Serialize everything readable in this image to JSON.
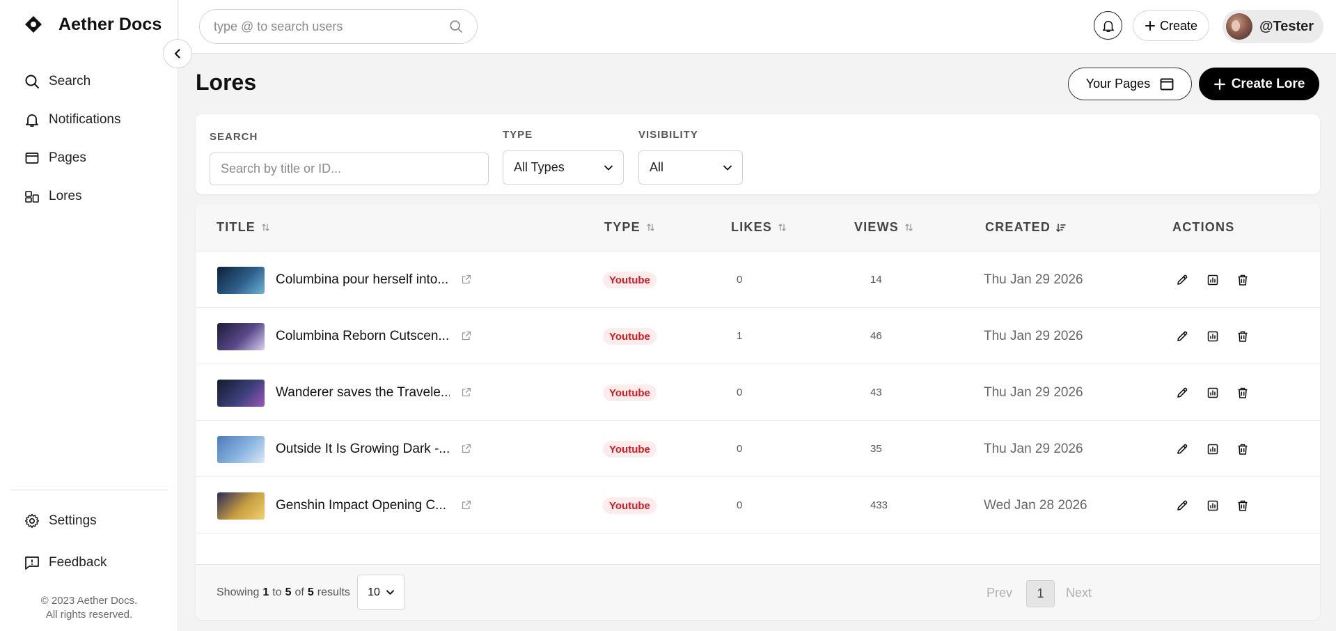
{
  "app": {
    "name": "Aether Docs"
  },
  "sidebar": {
    "items": [
      {
        "label": "Search",
        "icon": "search-icon"
      },
      {
        "label": "Notifications",
        "icon": "bell-icon"
      },
      {
        "label": "Pages",
        "icon": "window-icon"
      },
      {
        "label": "Lores",
        "icon": "layout-icon"
      }
    ],
    "bottom_items": [
      {
        "label": "Settings",
        "icon": "gear-icon"
      },
      {
        "label": "Feedback",
        "icon": "message-icon"
      }
    ],
    "copyright_line1": "© 2023 Aether Docs.",
    "copyright_line2": "All rights reserved."
  },
  "topbar": {
    "search_placeholder": "type @ to search users",
    "create_label": "Create",
    "username": "@Tester"
  },
  "page": {
    "title": "Lores",
    "your_pages_label": "Your Pages",
    "create_lore_label": "Create Lore"
  },
  "filters": {
    "search_label": "SEARCH",
    "search_placeholder": "Search by title or ID...",
    "type_label": "TYPE",
    "type_value": "All Types",
    "visibility_label": "VISIBILITY",
    "visibility_value": "All"
  },
  "table": {
    "columns": [
      "TITLE",
      "TYPE",
      "LIKES",
      "VIEWS",
      "CREATED",
      "ACTIONS"
    ],
    "rows": [
      {
        "title": "Columbina pour herself into...",
        "type": "Youtube",
        "likes": "0",
        "views": "14",
        "created": "Thu Jan 29 2026",
        "thumb_colors": [
          "#0e1f3a",
          "#2d5f8a",
          "#6fb2d8"
        ]
      },
      {
        "title": "Columbina Reborn Cutscen...",
        "type": "Youtube",
        "likes": "1",
        "views": "46",
        "created": "Thu Jan 29 2026",
        "thumb_colors": [
          "#1c1a3a",
          "#5a4a8a",
          "#d8d0f0"
        ]
      },
      {
        "title": "Wanderer saves the Travele...",
        "type": "Youtube",
        "likes": "0",
        "views": "43",
        "created": "Thu Jan 29 2026",
        "thumb_colors": [
          "#141a2e",
          "#3b3f7a",
          "#9a5ab8"
        ]
      },
      {
        "title": "Outside It Is Growing Dark -...",
        "type": "Youtube",
        "likes": "0",
        "views": "35",
        "created": "Thu Jan 29 2026",
        "thumb_colors": [
          "#4a7ab8",
          "#8ab4e0",
          "#dde9f5"
        ]
      },
      {
        "title": "Genshin Impact Opening C...",
        "type": "Youtube",
        "likes": "0",
        "views": "433",
        "created": "Wed Jan 28 2026",
        "thumb_colors": [
          "#2a2a5a",
          "#c8a040",
          "#f0d070"
        ]
      }
    ]
  },
  "footer": {
    "showing_prefix": "Showing",
    "from": "1",
    "to_word": "to",
    "to": "5",
    "of_word": "of",
    "total": "5",
    "results_word": "results",
    "per_page": "10",
    "prev_label": "Prev",
    "current_page": "1",
    "next_label": "Next"
  },
  "colors": {
    "accent": "#000000",
    "badge_bg": "#fdecec",
    "badge_text": "#d01c24"
  }
}
